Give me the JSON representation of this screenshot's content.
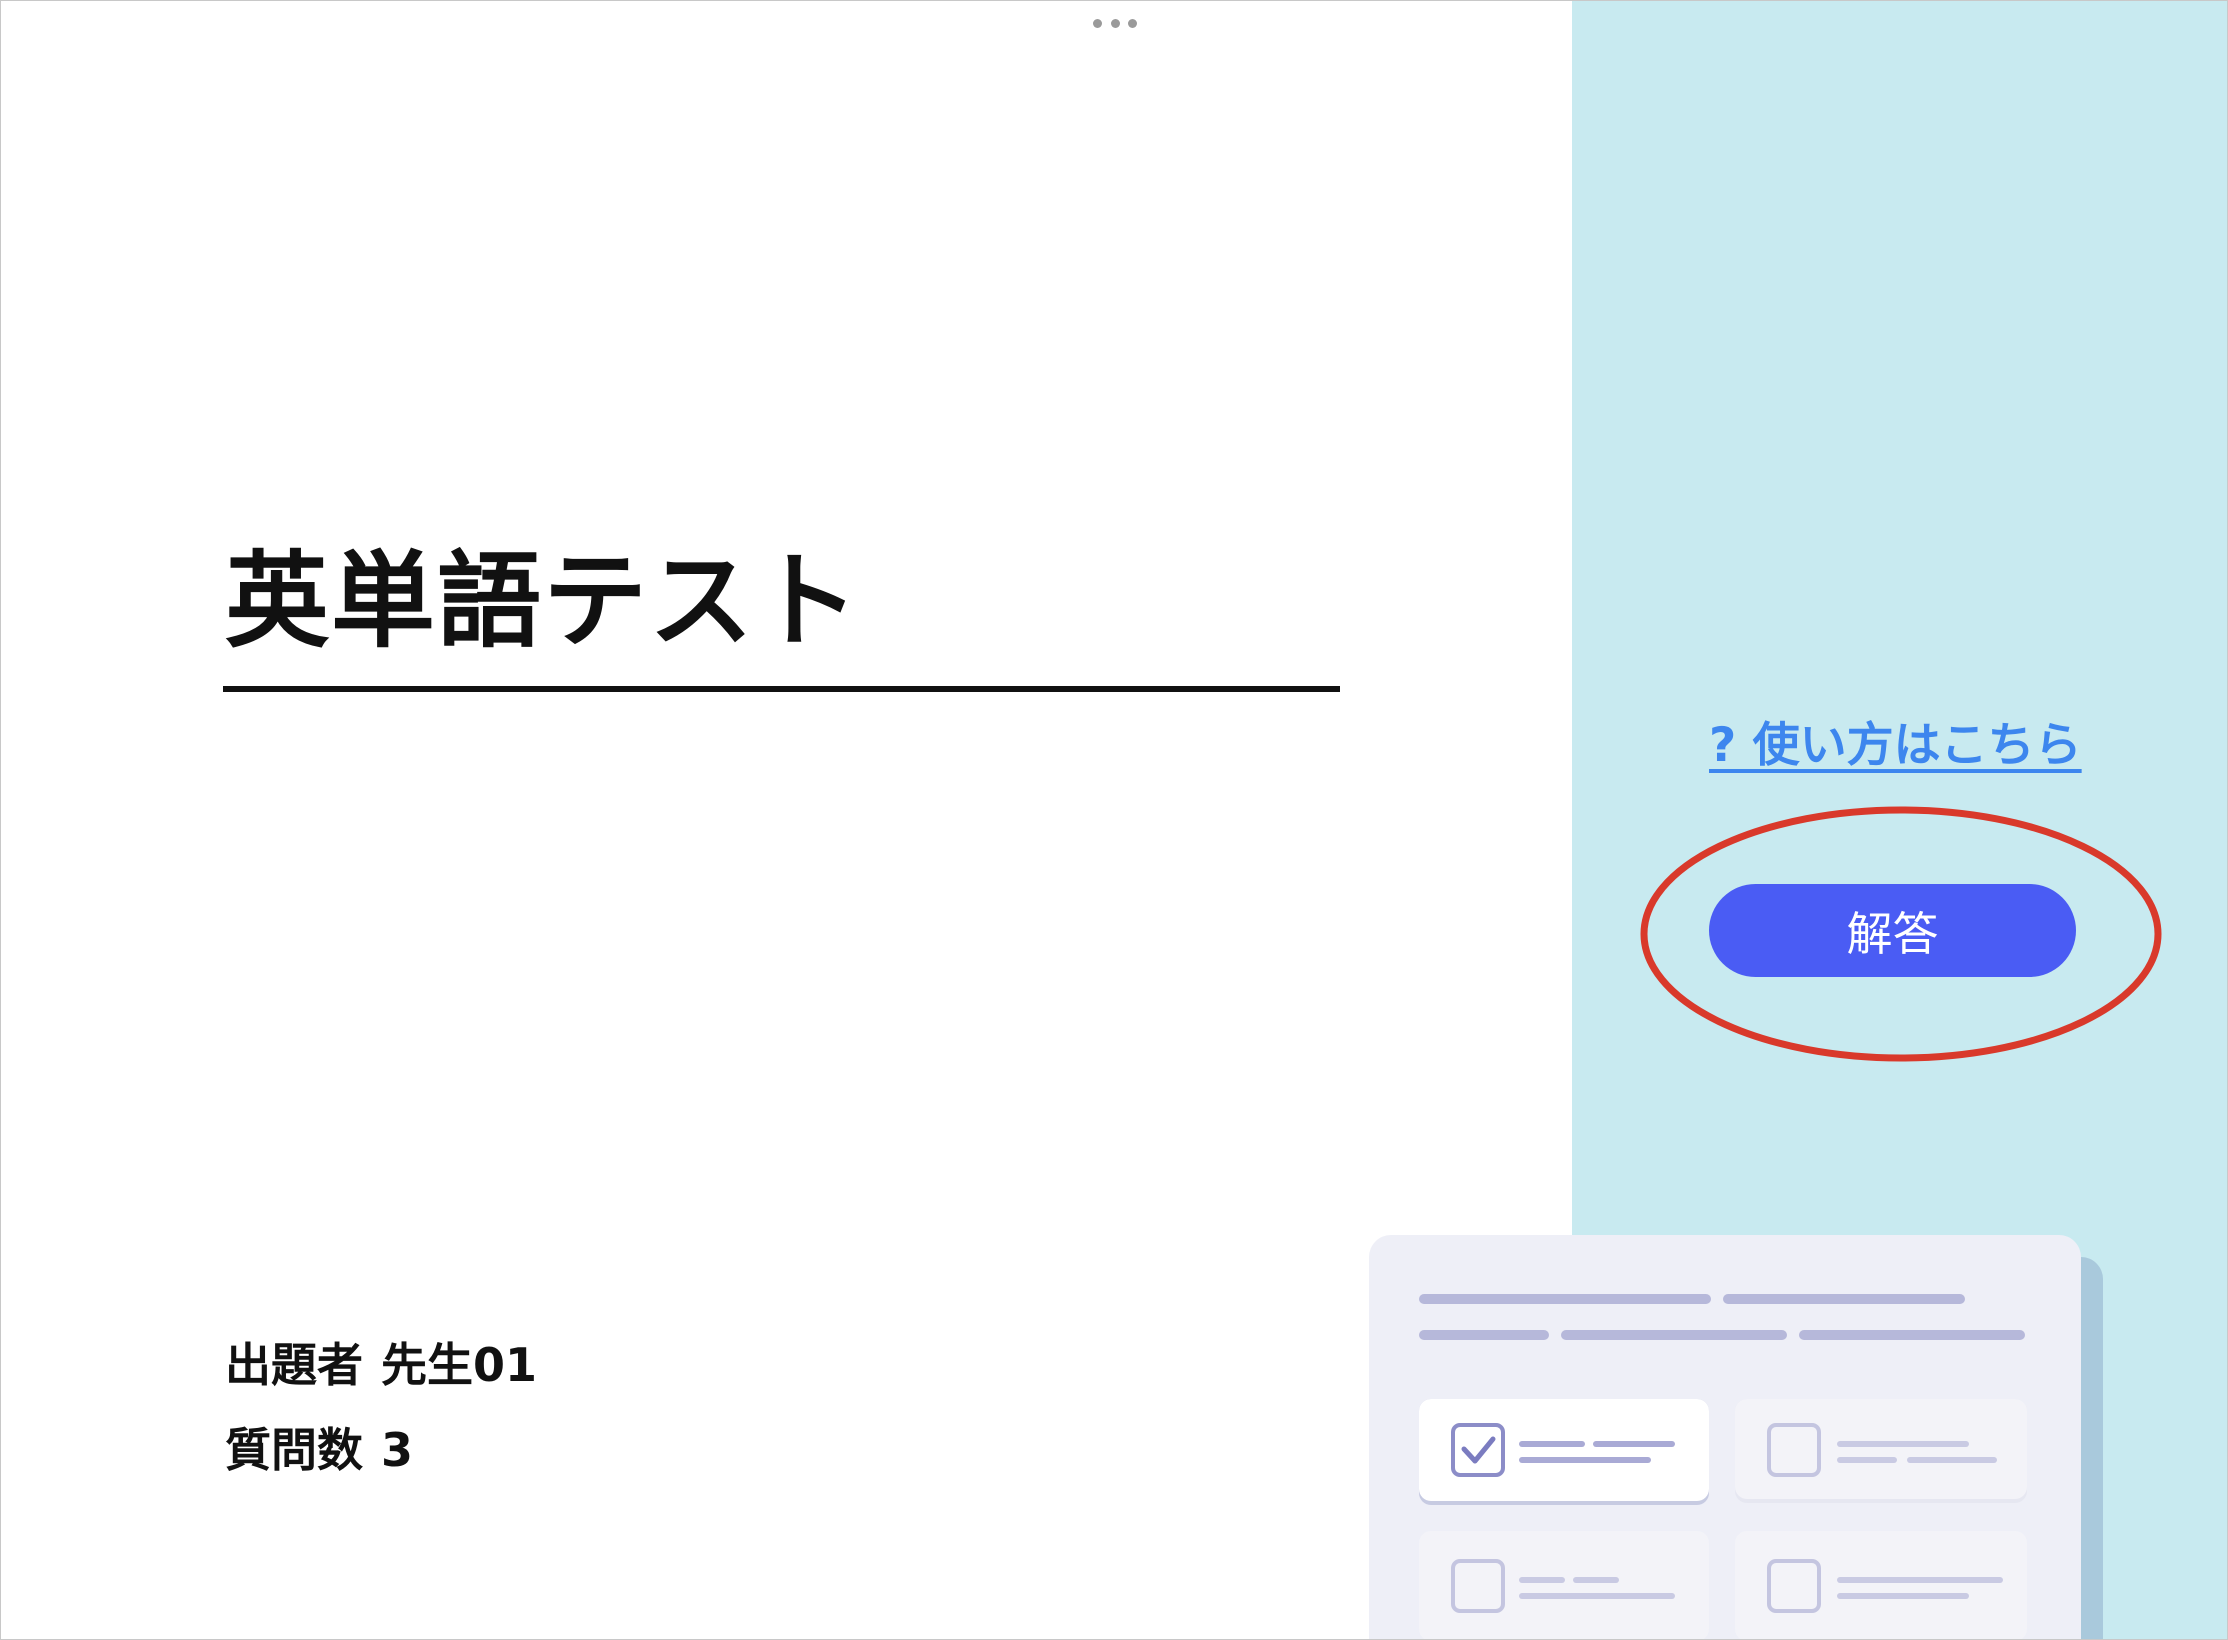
{
  "quiz": {
    "title": "英単語テスト",
    "author_label": "出題者",
    "author_value": "先生01",
    "question_count_label": "質問数",
    "question_count_value": "3"
  },
  "actions": {
    "help_link": "? 使い方はこちら",
    "answer_button": "解答"
  },
  "colors": {
    "accent": "#4a5cf4",
    "link": "#3d86ee",
    "panel_bg": "#c8eaf0",
    "highlight": "#d9392b"
  },
  "icons": [
    "more-dots-icon",
    "checkbox-checked-icon",
    "checkbox-empty-icon"
  ]
}
